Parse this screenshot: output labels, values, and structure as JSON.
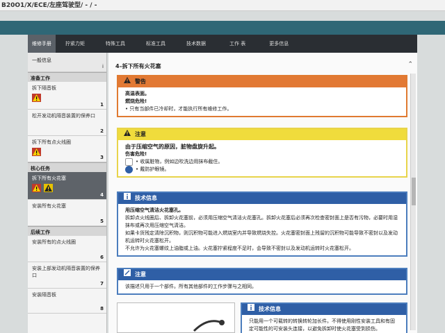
{
  "window": {
    "title": "B20O1/X/ECE/左座驾驶型/ - / -"
  },
  "nav": {
    "tabs": [
      "维修手册",
      "拧紧力矩",
      "特殊工具",
      "标准工具",
      "技术数据",
      "工作 表",
      "更多信息"
    ],
    "active": 0
  },
  "sidebar": {
    "general": {
      "label": "一般信息",
      "index": "i"
    },
    "sections": [
      {
        "title": "准备工作",
        "items": [
          {
            "label": "拆下隔音板",
            "num": "1",
            "icons": [
              "warning-red"
            ]
          },
          {
            "label": "松开发动机隔音装置的保养口",
            "num": "2",
            "icons": []
          },
          {
            "label": "拆下所有点火线圈",
            "num": "3",
            "icons": [
              "warning-red"
            ]
          }
        ]
      },
      {
        "title": "核心任务",
        "items": [
          {
            "label": "拆下所有火花塞",
            "num": "4",
            "icons": [
              "warning-red",
              "warning-yellow"
            ],
            "active": true
          },
          {
            "label": "安装所有火花塞",
            "num": "5",
            "icons": []
          }
        ]
      },
      {
        "title": "后续工作",
        "items": [
          {
            "label": "安装所有的点火线圈",
            "num": "6",
            "icons": []
          },
          {
            "label": "安装上部发动机隔音装置的保养口",
            "num": "7",
            "icons": []
          },
          {
            "label": "安装隔音板",
            "num": "8",
            "icons": []
          }
        ]
      }
    ]
  },
  "main": {
    "heading": "4–拆下所有火花塞",
    "warning": {
      "title": "警告",
      "line1": "高温表面。",
      "line2": "燃烧危险!",
      "bullet1": "• 只有当部件已冷却时，才能执行所有维修工作。"
    },
    "caution": {
      "title": "注意",
      "line1": "由于压缩空气的原因，脏物盘旋升起。",
      "line2": "伤害危险!",
      "bullet1": "• 收属脏物，例如边吹洗边用抹布截住。",
      "bullet2": "• 戴防护眼镜。"
    },
    "tech1": {
      "title": "技术信息",
      "line1": "用压缩空气清洁火花塞孔。",
      "para1": "拆卸点火线圈后、拆卸火花塞前，必须用压缩空气清洁火花塞孔。拆卸火花塞后必须再次检查密封面上是否有污物，必要时用湿抹布或再次用压缩空气清洁。",
      "para2": "如果卡货残定清除沉积物，则沉积物可能进入燃烧室内并导致燃烧失控。火花塞密封面上残留的沉积物可能导致不密封以及发动机运转时火花塞松开。",
      "para3": "不允许为火花塞螺纹上油脂或上油。火花塞拧紧程度不足时，会导致不密封以及发动机运转时火花塞松开。"
    },
    "note2": {
      "title": "注意",
      "line1": "该描述只用于一个部件。所有其他部件的工作步骤与之相同。"
    },
    "tech2": {
      "title": "技术信息",
      "line1": "只能用一个可载转的转换转轮加长件。不得使用刚性安装工具和有固定可能性的可安装头连接，以避免拆卸时使火花塞受到损伤。"
    }
  }
}
